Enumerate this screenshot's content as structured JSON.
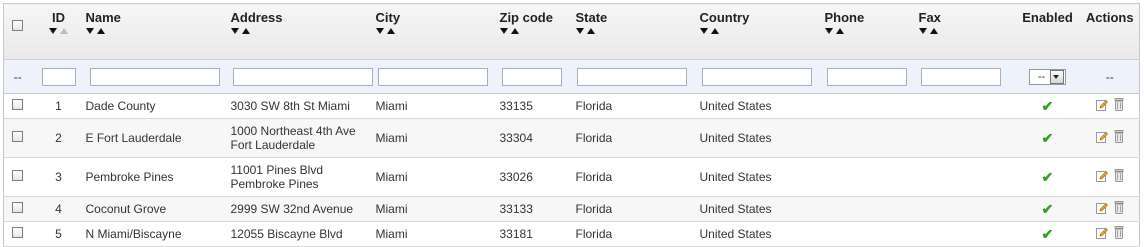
{
  "columns": {
    "id": "ID",
    "name": "Name",
    "address": "Address",
    "city": "City",
    "zip": "Zip code",
    "state": "State",
    "country": "Country",
    "phone": "Phone",
    "fax": "Fax",
    "enabled": "Enabled",
    "actions": "Actions"
  },
  "filter": {
    "bulk_label": "--",
    "enabled_select_value": "--",
    "actions_label": "--"
  },
  "icons": {
    "enabled": "check-icon",
    "edit": "pencil-icon",
    "delete": "trash-icon",
    "sort_desc": "arrow-down-icon",
    "sort_asc": "arrow-up-icon"
  },
  "colors": {
    "check": "#3a9b2a",
    "filter_bg": "#eef3fb"
  },
  "rows": [
    {
      "id": "1",
      "name": "Dade County",
      "address_line1": "3030 SW 8th St Miami",
      "address_line2": "",
      "city": "Miami",
      "zip": "33135",
      "state": "Florida",
      "country": "United States",
      "phone": "",
      "fax": "",
      "enabled": "✔"
    },
    {
      "id": "2",
      "name": "E Fort Lauderdale",
      "address_line1": "1000 Northeast 4th Ave",
      "address_line2": "Fort Lauderdale",
      "city": "Miami",
      "zip": "33304",
      "state": "Florida",
      "country": "United States",
      "phone": "",
      "fax": "",
      "enabled": "✔"
    },
    {
      "id": "3",
      "name": "Pembroke Pines",
      "address_line1": "11001 Pines Blvd",
      "address_line2": "Pembroke Pines",
      "city": "Miami",
      "zip": "33026",
      "state": "Florida",
      "country": "United States",
      "phone": "",
      "fax": "",
      "enabled": "✔"
    },
    {
      "id": "4",
      "name": "Coconut Grove",
      "address_line1": "2999 SW 32nd Avenue",
      "address_line2": "",
      "city": "Miami",
      "zip": "33133",
      "state": "Florida",
      "country": "United States",
      "phone": "",
      "fax": "",
      "enabled": "✔"
    },
    {
      "id": "5",
      "name": "N Miami/Biscayne",
      "address_line1": "12055 Biscayne Blvd",
      "address_line2": "",
      "city": "Miami",
      "zip": "33181",
      "state": "Florida",
      "country": "United States",
      "phone": "",
      "fax": "",
      "enabled": "✔"
    }
  ]
}
